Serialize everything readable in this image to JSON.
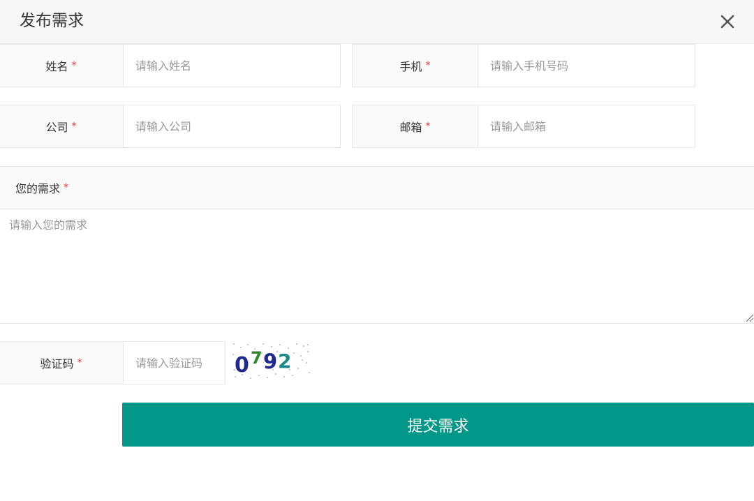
{
  "dialog": {
    "title": "发布需求",
    "close_icon": "close-icon"
  },
  "form": {
    "required_mark": "*",
    "name": {
      "label": "姓名",
      "placeholder": "请输入姓名",
      "value": ""
    },
    "phone": {
      "label": "手机",
      "placeholder": "请输入手机号码",
      "value": ""
    },
    "company": {
      "label": "公司",
      "placeholder": "请输入公司",
      "value": ""
    },
    "email": {
      "label": "邮箱",
      "placeholder": "请输入邮箱",
      "value": ""
    },
    "need": {
      "label": "您的需求",
      "placeholder": "请输入您的需求",
      "value": ""
    },
    "captcha": {
      "label": "验证码",
      "placeholder": "请输入验证码",
      "value": "",
      "image_text": "0792"
    },
    "submit_label": "提交需求"
  },
  "colors": {
    "accent": "#029789",
    "required": "#e4393c",
    "header_bg": "#f7f7f7",
    "label_bg": "#f9f9f9"
  }
}
